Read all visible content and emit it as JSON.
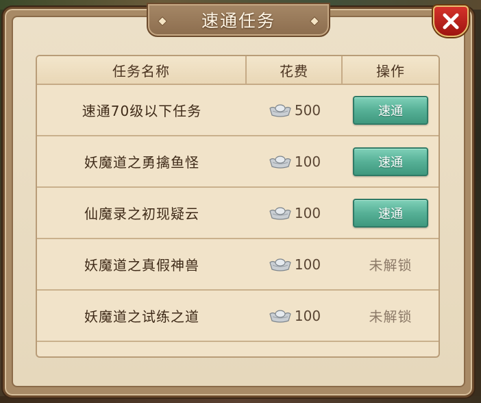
{
  "dialog": {
    "title": "速通任务",
    "close_label": "×"
  },
  "table": {
    "headers": {
      "name": "任务名称",
      "cost": "花费",
      "action": "操作"
    },
    "rows": [
      {
        "name": "速通70级以下任务",
        "cost": "500",
        "action": "速通",
        "unlocked": true
      },
      {
        "name": "妖魔道之勇擒鱼怪",
        "cost": "100",
        "action": "速通",
        "unlocked": true
      },
      {
        "name": "仙魔录之初现疑云",
        "cost": "100",
        "action": "速通",
        "unlocked": true
      },
      {
        "name": "妖魔道之真假神兽",
        "cost": "100",
        "action": "未解锁",
        "unlocked": false
      },
      {
        "name": "妖魔道之试练之道",
        "cost": "100",
        "action": "未解锁",
        "unlocked": false
      }
    ]
  },
  "icons": {
    "cost_icon": "silver-ingot-icon",
    "close_icon": "close-x-icon"
  },
  "colors": {
    "accent_button": "#56b096",
    "close_button": "#c4241c",
    "panel": "#ece0c8",
    "frame": "#a88a66",
    "locked_text": "#8c7a68"
  }
}
